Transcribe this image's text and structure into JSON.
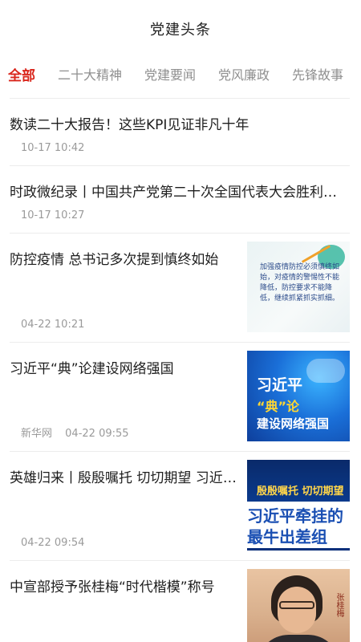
{
  "header": {
    "title": "党建头条"
  },
  "tabs": [
    {
      "label": "全部",
      "active": true
    },
    {
      "label": "二十大精神",
      "active": false
    },
    {
      "label": "党建要闻",
      "active": false
    },
    {
      "label": "党风廉政",
      "active": false
    },
    {
      "label": "先锋故事",
      "active": false
    }
  ],
  "feed": [
    {
      "title": "数读二十大报告！这些KPI见证非凡十年",
      "source": "",
      "time": "10-17 10:42"
    },
    {
      "title": "时政微纪录丨中国共产党第二十次全国代表大会胜利开幕",
      "source": "",
      "time": "10-17 10:27"
    },
    {
      "title": "防控疫情 总书记多次提到慎终如始",
      "source": "",
      "time": "04-22 10:21",
      "thumb_text": "加强疫情防控必须慎终如始，对疫情的警惕性不能降低，防控要求不能降低，继续抓紧抓实抓细。"
    },
    {
      "title": "习近平“典”论建设网络强国",
      "source": "新华网",
      "time": "04-22 09:55",
      "thumb_text": [
        "习近平",
        "“典”论",
        "建设网络强国"
      ]
    },
    {
      "title": "英雄归来丨殷殷嘱托 切切期望 习近平牵挂的最牛出差组",
      "source": "",
      "time": "04-22 09:54",
      "thumb_text": [
        "殷殷嘱托 切切期望",
        "习近平牵挂的",
        "最牛出差组"
      ]
    },
    {
      "title": "中宣部授予张桂梅“时代楷模”称号",
      "source": "",
      "time": "",
      "thumb_text": "张桂梅"
    }
  ]
}
